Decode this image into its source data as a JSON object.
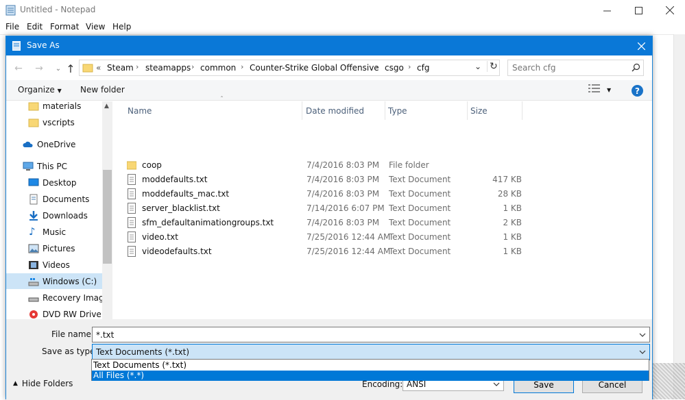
{
  "notepad": {
    "title": "Untitled - Notepad",
    "menu": [
      "File",
      "Edit",
      "Format",
      "View",
      "Help"
    ]
  },
  "dialog": {
    "title": "Save As",
    "breadcrumbs": [
      "«",
      "Steam",
      "steamapps",
      "common",
      "Counter-Strike Global Offensive",
      "csgo",
      "cfg"
    ],
    "search_placeholder": "Search cfg",
    "toolbar": {
      "organize": "Organize",
      "new_folder": "New folder",
      "help": "?"
    },
    "nav_items": [
      {
        "label": "materials",
        "icon": "folder-icon"
      },
      {
        "label": "vscripts",
        "icon": "folder-icon"
      },
      {
        "label": "OneDrive",
        "icon": "cloud-icon"
      },
      {
        "label": "This PC",
        "icon": "computer-icon"
      },
      {
        "label": "Desktop",
        "icon": "desktop-icon"
      },
      {
        "label": "Documents",
        "icon": "documents-icon"
      },
      {
        "label": "Downloads",
        "icon": "download-icon"
      },
      {
        "label": "Music",
        "icon": "music-icon"
      },
      {
        "label": "Pictures",
        "icon": "pictures-icon"
      },
      {
        "label": "Videos",
        "icon": "videos-icon"
      },
      {
        "label": "Windows (C:)",
        "icon": "drive-icon"
      },
      {
        "label": "Recovery Image",
        "icon": "drive-icon"
      },
      {
        "label": "DVD RW Drive (E",
        "icon": "dvd-icon"
      }
    ],
    "columns": {
      "name": "Name",
      "date": "Date modified",
      "type": "Type",
      "size": "Size"
    },
    "files": [
      {
        "name": "coop",
        "date": "7/4/2016 8:03 PM",
        "type": "File folder",
        "size": ""
      },
      {
        "name": "moddefaults.txt",
        "date": "7/4/2016 8:03 PM",
        "type": "Text Document",
        "size": "417 KB"
      },
      {
        "name": "moddefaults_mac.txt",
        "date": "7/4/2016 8:03 PM",
        "type": "Text Document",
        "size": "28 KB"
      },
      {
        "name": "server_blacklist.txt",
        "date": "7/14/2016 6:07 PM",
        "type": "Text Document",
        "size": "1 KB"
      },
      {
        "name": "sfm_defaultanimationgroups.txt",
        "date": "7/4/2016 8:03 PM",
        "type": "Text Document",
        "size": "2 KB"
      },
      {
        "name": "video.txt",
        "date": "7/25/2016 12:44 AM",
        "type": "Text Document",
        "size": "1 KB"
      },
      {
        "name": "videodefaults.txt",
        "date": "7/25/2016 12:44 AM",
        "type": "Text Document",
        "size": "1 KB"
      }
    ],
    "file_name_label": "File name:",
    "file_name_value": "*.txt",
    "save_type_label": "Save as type:",
    "save_type_value": "Text Documents (*.txt)",
    "save_type_options": [
      "Text Documents (*.txt)",
      "All Files  (*.*)"
    ],
    "encoding_label": "Encoding:",
    "encoding_value": "ANSI",
    "save_label": "Save",
    "cancel_label": "Cancel",
    "hide_folders_label": "Hide Folders"
  },
  "colors": {
    "accent": "#0a78d7",
    "selection": "#cce4f7",
    "option_selected": "#0078d7"
  }
}
